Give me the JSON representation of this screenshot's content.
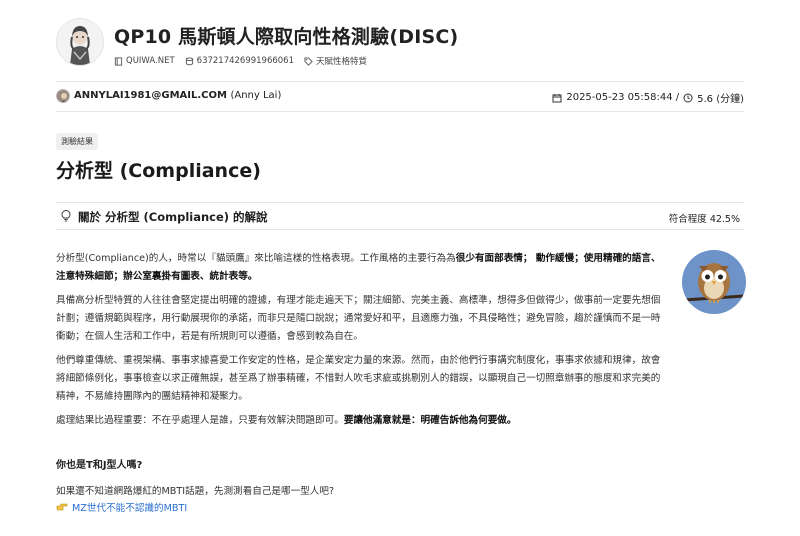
{
  "header": {
    "title": "QP10 馬斯頓人際取向性格測驗(DISC)",
    "site": "QUIWA.NET",
    "id": "637217426991966061",
    "category": "天賦性格特質"
  },
  "author": {
    "email": "ANNYLAI1981@GMAIL.COM",
    "name": "(Anny Lai)",
    "datetime": "2025-05-23 05:58:44 /",
    "duration": "5.6 (分鐘)"
  },
  "result": {
    "tag": "測驗結果",
    "heading": "分析型 (Compliance)",
    "section_title": "關於 分析型 (Compliance) 的解說",
    "match": "符合程度 42.5%"
  },
  "body": {
    "p1a": "分析型(Compliance)的人，時常以『貓頭鷹』來比喻這樣的性格表現。工作風格的主要行為為",
    "p1b": "很少有面部表情； 動作緩慢；使用精確的語言、注意特殊細節；辦公室裏掛有圖表、統計表等。",
    "p2": "具備高分析型特質的人往往會堅定提出明確的證據，有理才能走遍天下；關注細節、完美主義、高標準，想得多但做得少，做事前一定要先想個計劃；遵循規範與程序，用行動展現你的承諾，而非只是隨口說說；通常愛好和平，且適應力強，不具侵略性；避免冒險，趨於謹慎而不是一時衝動；在個人生活和工作中，若是有所規則可以遵循，會感到較為自在。",
    "p3": "他們尊重傳統、重視架構、事事求據喜愛工作安定的性格，是企業安定力量的來源。然而，由於他們行事講究制度化，事事求依據和規律，故會將細節條例化，事事檢查以求正確無誤，甚至爲了辦事精確，不惜對人吹毛求疵或挑剔別人的錯誤，以顯現自己一切照章辦事的態度和求完美的精神，不易維持團隊內的團結精神和凝聚力。",
    "p4a": "處理結果比過程重要：不在乎處理人是誰，只要有效解決問題即可。",
    "p4b": "要讓他滿意就是：明確告訴他為何要做。"
  },
  "mbti": {
    "question": "你也是T和J型人嗎?",
    "desc": "如果還不知道網路爆紅的MBTI話題，先測測看自己是哪一型人吧?",
    "link": "MZ世代不能不認識的MBTI"
  },
  "colors": {
    "link": "#2a6fd1",
    "owl_bg": "#dfe6f1"
  }
}
